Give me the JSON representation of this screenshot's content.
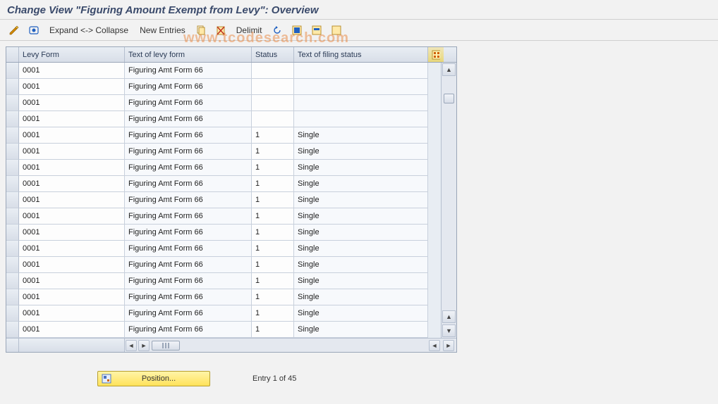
{
  "title": "Change View \"Figuring Amount Exempt from Levy\": Overview",
  "toolbar": {
    "expand_collapse": "Expand <-> Collapse",
    "new_entries": "New Entries",
    "delimit": "Delimit"
  },
  "columns": {
    "levy_form": "Levy Form",
    "text_levy": "Text of levy form",
    "status": "Status",
    "text_filing": "Text of filing status"
  },
  "rows": [
    {
      "levy": "0001",
      "text": "Figuring Amt Form 66",
      "status": "",
      "filing": ""
    },
    {
      "levy": "0001",
      "text": "Figuring Amt Form 66",
      "status": "",
      "filing": ""
    },
    {
      "levy": "0001",
      "text": "Figuring Amt Form 66",
      "status": "",
      "filing": ""
    },
    {
      "levy": "0001",
      "text": "Figuring Amt Form 66",
      "status": "",
      "filing": ""
    },
    {
      "levy": "0001",
      "text": "Figuring Amt Form 66",
      "status": "1",
      "filing": "Single"
    },
    {
      "levy": "0001",
      "text": "Figuring Amt Form 66",
      "status": "1",
      "filing": "Single"
    },
    {
      "levy": "0001",
      "text": "Figuring Amt Form 66",
      "status": "1",
      "filing": "Single"
    },
    {
      "levy": "0001",
      "text": "Figuring Amt Form 66",
      "status": "1",
      "filing": "Single"
    },
    {
      "levy": "0001",
      "text": "Figuring Amt Form 66",
      "status": "1",
      "filing": "Single"
    },
    {
      "levy": "0001",
      "text": "Figuring Amt Form 66",
      "status": "1",
      "filing": "Single"
    },
    {
      "levy": "0001",
      "text": "Figuring Amt Form 66",
      "status": "1",
      "filing": "Single"
    },
    {
      "levy": "0001",
      "text": "Figuring Amt Form 66",
      "status": "1",
      "filing": "Single"
    },
    {
      "levy": "0001",
      "text": "Figuring Amt Form 66",
      "status": "1",
      "filing": "Single"
    },
    {
      "levy": "0001",
      "text": "Figuring Amt Form 66",
      "status": "1",
      "filing": "Single"
    },
    {
      "levy": "0001",
      "text": "Figuring Amt Form 66",
      "status": "1",
      "filing": "Single"
    },
    {
      "levy": "0001",
      "text": "Figuring Amt Form 66",
      "status": "1",
      "filing": "Single"
    },
    {
      "levy": "0001",
      "text": "Figuring Amt Form 66",
      "status": "1",
      "filing": "Single"
    }
  ],
  "footer": {
    "position_label": "Position...",
    "entry_text": "Entry 1 of 45"
  },
  "watermark": "www.tcodesearch.com"
}
